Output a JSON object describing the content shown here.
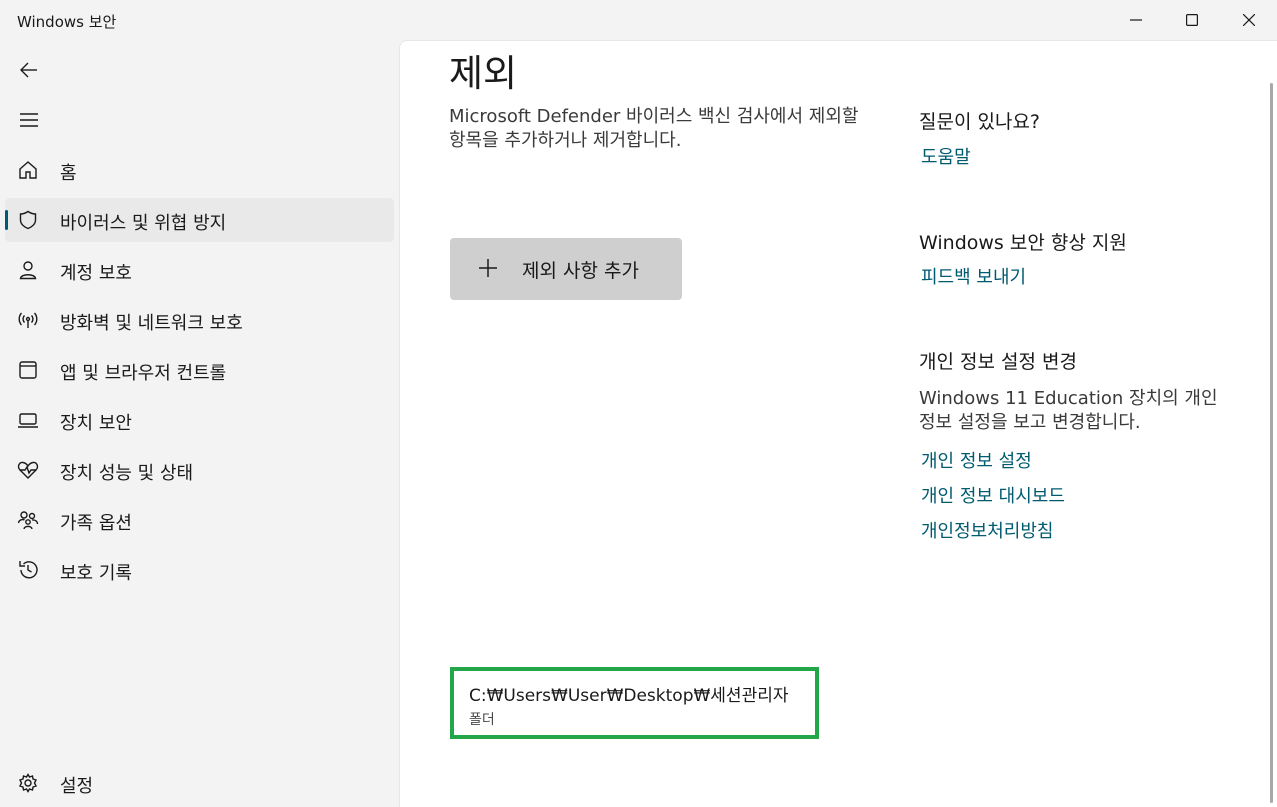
{
  "window": {
    "title": "Windows 보안",
    "controls": [
      "minimize-icon",
      "maximize-icon",
      "close-icon"
    ]
  },
  "sidebar": {
    "back_icon": "back-arrow-icon",
    "menu_icon": "hamburger-menu-icon",
    "items": [
      {
        "label": "홈",
        "icon": "home-icon"
      },
      {
        "label": "바이러스 및 위협 방지",
        "icon": "shield-icon",
        "active": true
      },
      {
        "label": "계정 보호",
        "icon": "person-icon"
      },
      {
        "label": "방화벽 및 네트워크 보호",
        "icon": "antenna-icon"
      },
      {
        "label": "앱 및 브라우저 컨트롤",
        "icon": "browser-window-icon"
      },
      {
        "label": "장치 보안",
        "icon": "laptop-icon"
      },
      {
        "label": "장치 성능 및 상태",
        "icon": "heart-pulse-icon"
      },
      {
        "label": "가족 옵션",
        "icon": "family-icon"
      },
      {
        "label": "보호 기록",
        "icon": "history-icon"
      }
    ],
    "settings": {
      "label": "설정",
      "icon": "gear-icon"
    }
  },
  "main": {
    "title": "제외",
    "description": "Microsoft Defender 바이러스 백신 검사에서 제외할 항목을 추가하거나 제거합니다.",
    "add_button": {
      "label": "제외 사항 추가",
      "icon": "plus-icon"
    },
    "exclusions": [
      {
        "path": "C:₩Users₩User₩Desktop₩세션관리자",
        "type": "폴더"
      }
    ],
    "accent_color": "#005a70",
    "highlight_color": "#22a648"
  },
  "side_panel": {
    "question": {
      "heading": "질문이 있나요?",
      "link": "도움말"
    },
    "improve": {
      "heading": "Windows 보안 향상 지원",
      "link": "피드백 보내기"
    },
    "privacy": {
      "heading": "개인 정보 설정 변경",
      "text": "Windows 11 Education 장치의 개인 정보 설정을 보고 변경합니다.",
      "links": [
        "개인 정보 설정",
        "개인 정보 대시보드",
        "개인정보처리방침"
      ]
    }
  }
}
